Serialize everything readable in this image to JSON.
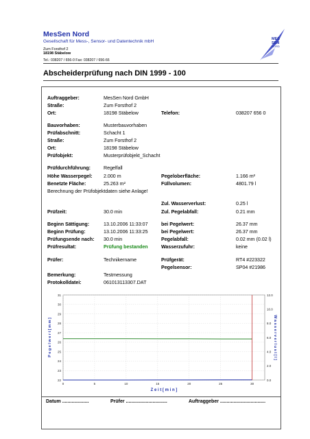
{
  "header": {
    "company": "MesSen Nord",
    "subtitle": "Gesellschaft für Mess-, Sensor- und Datentechnik mbH",
    "street": "Zum Forsthof 2",
    "city": "18198 Stäbelow",
    "contact": "Tel.: 038207 / 656-0   Fax: 038207 / 656-66",
    "logo_text": [
      "MES",
      "SEN",
      "NORD"
    ]
  },
  "title": "Abscheiderprüfung nach DIN 1999 - 100",
  "client": {
    "auftraggeber_label": "Auftraggeber:",
    "auftraggeber": "MesSen Nord GmbH",
    "strasse_label": "Straße:",
    "strasse": "Zum Forsthof 2",
    "ort_label": "Ort:",
    "ort": "18198 Stäbelow",
    "telefon_label": "Telefon:",
    "telefon": "038207 656 0"
  },
  "project": {
    "bauvorhaben_label": "Bauvorhaben:",
    "bauvorhaben": "Musterbauvorhaben",
    "abschnitt_label": "Prüfabschnitt:",
    "abschnitt": "Schacht 1",
    "strasse_label": "Straße:",
    "strasse": "Zum Forsthof 2",
    "ort_label": "Ort:",
    "ort": "18198 Stäbelow",
    "objekt_label": "Prüfobjekt:",
    "objekt": "Musterprüfobjekt_Schacht"
  },
  "test": {
    "durchfuehrung_label": "Prüfdurchführung:",
    "durchfuehrung": "Regelfall",
    "wasserpegel_label": "Höhe Wasserpegel:",
    "wasserpegel": "2.000 m",
    "pegeloberflaeche_label": "Pegeloberfläche:",
    "pegeloberflaeche": "1.166 m²",
    "flaeche_label": "Benetzte Fläche:",
    "flaeche": "25.263 m²",
    "fuellvolumen_label": "Füllvolumen:",
    "fuellvolumen": "4801.79 l",
    "note": "Berechnung der Prüfobjektdaten siehe Anlage!",
    "zul_verlust_label": "Zul. Wasserverlust:",
    "zul_verlust": "0.25 l",
    "pruefzeit_label": "Prüfzeit:",
    "pruefzeit": "30.0 min",
    "zul_pegelabfall_label": "Zul. Pegelabfall:",
    "zul_pegelabfall": "0.21 mm"
  },
  "results": {
    "beginn_saett_label": "Beginn Sättigung:",
    "beginn_saett": "13.10.2006 11:33:07",
    "pegelwert1_label": "bei Pegelwert:",
    "pegelwert1": "26.37 mm",
    "beginn_pruef_label": "Beginn Prüfung:",
    "beginn_pruef": "13.10.2006 11:33:25",
    "pegelwert2_label": "bei Pegelwert:",
    "pegelwert2": "26.37 mm",
    "ende_label": "Prüfungsende nach:",
    "ende": "30.0 min",
    "pegelabfall_label": "Pegelabfall:",
    "pegelabfall": "0.02 mm (0.02 l)",
    "resultat_label": "Prüfresultat:",
    "resultat": "Prüfung bestanden",
    "zufuhr_label": "Wasserzufuhr:",
    "zufuhr": "keine"
  },
  "device": {
    "pruefer_label": "Prüfer:",
    "pruefer": "Technikername",
    "geraet_label": "Prüfgerät:",
    "geraet": "RT4 #223322",
    "sensor_label": "Pegelsensor:",
    "sensor": "SP04 #21986",
    "bemerkung_label": "Bemerkung:",
    "bemerkung": "Testmessung",
    "datei_label": "Protokolldatei:",
    "datei": "061013113307.DAT"
  },
  "chart_data": {
    "type": "line",
    "xlabel": "Z e i t  [ m i n ]",
    "ylabel_left": "P e g e l w e r t  [ m m ]",
    "ylabel_right": "W a s s e r v e r l u s t  [ l ]",
    "x_ticks": [
      "0",
      "5",
      "10",
      "15",
      "20",
      "25",
      "30"
    ],
    "y_left_ticks": [
      "22",
      "23",
      "24",
      "25",
      "26",
      "27",
      "28",
      "29",
      "30",
      "31"
    ],
    "y_right_ticks": [
      "0.0",
      "2.0",
      "4.0",
      "6.0",
      "8.0",
      "10.0",
      "12.0"
    ],
    "xlim": [
      0,
      32
    ],
    "ylim_left": [
      22,
      31
    ],
    "ylim_right": [
      0,
      12
    ],
    "series": [
      {
        "name": "",
        "axis": "left",
        "color": "#2e8b2e",
        "x": [
          0,
          5,
          10,
          15,
          20,
          25,
          30
        ],
        "y": [
          26.37,
          26.37,
          26.37,
          26.36,
          26.36,
          26.35,
          26.35
        ]
      },
      {
        "name": "",
        "axis": "right",
        "color": "#2233aa",
        "x": [
          0,
          5,
          10,
          15,
          20,
          25,
          30
        ],
        "y": [
          0.0,
          0.0,
          0.0,
          0.01,
          0.01,
          0.02,
          0.02
        ]
      }
    ],
    "markers": [
      {
        "x": 30,
        "color": "#c03030"
      }
    ],
    "grid": true
  },
  "footer": {
    "datum": "Datum ....................",
    "pruefer": "Prüfer ...............................",
    "auftraggeber": "Auftraggeber .................................."
  },
  "colors": {
    "brand": "#1f2fa8",
    "pass": "#1a8a1a"
  }
}
